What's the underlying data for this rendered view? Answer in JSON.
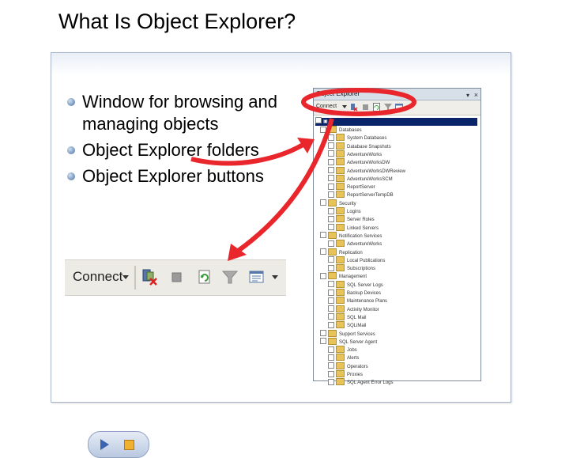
{
  "slide": {
    "title": "What Is Object Explorer?"
  },
  "bullets": [
    "Window for browsing and managing objects",
    "Object Explorer folders",
    "Object Explorer buttons"
  ],
  "toolbar_zoom": {
    "connect_label": "Connect",
    "icons": [
      "connect-dropdown-icon",
      "disconnect-icon",
      "stop-icon",
      "refresh-icon",
      "filter-icon",
      "summary-icon"
    ]
  },
  "object_explorer": {
    "title": "Object Explorer",
    "connect_label": "Connect",
    "server_node": "",
    "tree": [
      {
        "label": "Databases",
        "level": 1
      },
      {
        "label": "System Databases",
        "level": 2
      },
      {
        "label": "Database Snapshots",
        "level": 2
      },
      {
        "label": "AdventureWorks",
        "level": 2
      },
      {
        "label": "AdventureWorksDW",
        "level": 2
      },
      {
        "label": "AdventureWorksDWReview",
        "level": 2
      },
      {
        "label": "AdventureWorksSCM",
        "level": 2
      },
      {
        "label": "ReportServer",
        "level": 2
      },
      {
        "label": "ReportServerTempDB",
        "level": 2
      },
      {
        "label": "Security",
        "level": 1
      },
      {
        "label": "Logins",
        "level": 2
      },
      {
        "label": "Server Roles",
        "level": 2
      },
      {
        "label": "Linked Servers",
        "level": 2
      },
      {
        "label": "Notification Services",
        "level": 1
      },
      {
        "label": "AdventureWorks",
        "level": 2
      },
      {
        "label": "Replication",
        "level": 1
      },
      {
        "label": "Local Publications",
        "level": 2
      },
      {
        "label": "Subscriptions",
        "level": 2
      },
      {
        "label": "Management",
        "level": 1
      },
      {
        "label": "SQL Server Logs",
        "level": 2
      },
      {
        "label": "Backup Devices",
        "level": 2
      },
      {
        "label": "Maintenance Plans",
        "level": 2
      },
      {
        "label": "Activity Monitor",
        "level": 2
      },
      {
        "label": "SQL Mail",
        "level": 2
      },
      {
        "label": "SQLiMail",
        "level": 2
      },
      {
        "label": "Support Services",
        "level": 1
      },
      {
        "label": "SQL Server Agent",
        "level": 1
      },
      {
        "label": "Jobs",
        "level": 2
      },
      {
        "label": "Alerts",
        "level": 2
      },
      {
        "label": "Operators",
        "level": 2
      },
      {
        "label": "Proxies",
        "level": 2
      },
      {
        "label": "SQL Agent Error Logs",
        "level": 2
      }
    ]
  },
  "colors": {
    "annotation_red": "#e8262b",
    "panel_border": "#a9b6c9",
    "selection_blue": "#0a246a"
  }
}
